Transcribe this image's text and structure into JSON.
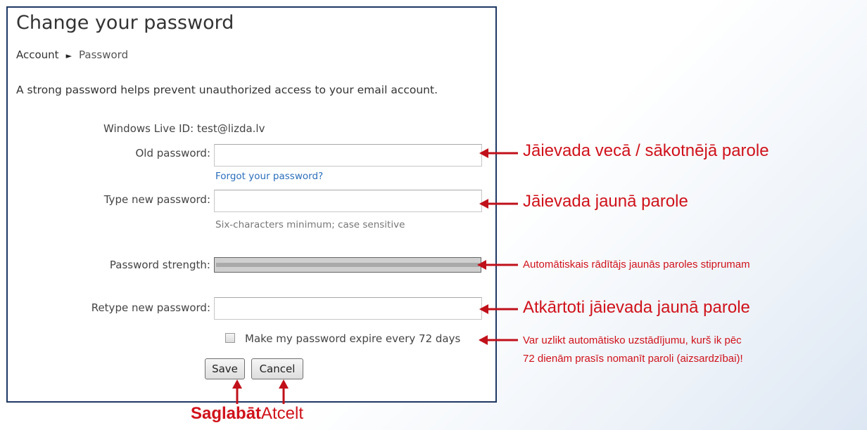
{
  "page": {
    "title": "Change your password",
    "breadcrumb": {
      "parent": "Account",
      "separator": "►",
      "current": "Password"
    },
    "intro": "A strong password helps prevent unauthorized access to your email account."
  },
  "form": {
    "id_label": "Windows Live ID:",
    "id_value": "test@lizda.lv",
    "old_label": "Old password:",
    "old_value": "",
    "forgot_link": "Forgot your password?",
    "new_label": "Type new password:",
    "new_value": "",
    "new_hint": "Six-characters minimum; case sensitive",
    "strength_label": "Password strength:",
    "strength_level": 0,
    "retype_label": "Retype new password:",
    "retype_value": "",
    "expire_label": "Make my password expire every 72 days",
    "expire_checked": false,
    "save_label": "Save",
    "cancel_label": "Cancel"
  },
  "annotations": {
    "old": "Jāievada vecā / sākotnējā parole",
    "new": "Jāievada jaunā parole",
    "strength": "Automātiskais rādītājs jaunās paroles stiprumam",
    "retype": "Atkārtoti jāievada jaunā parole",
    "expire_line1": "Var uzlikt automātisko uzstādījumu, kurš ik pēc",
    "expire_line2": "72 dienām prasīs nomanīt paroli (aizsardzībai)!",
    "save": "Saglabāt",
    "cancel": "Atcelt"
  },
  "colors": {
    "annotation": "#d0121b",
    "panel_border": "#1f3864",
    "link": "#2a6ebb"
  }
}
